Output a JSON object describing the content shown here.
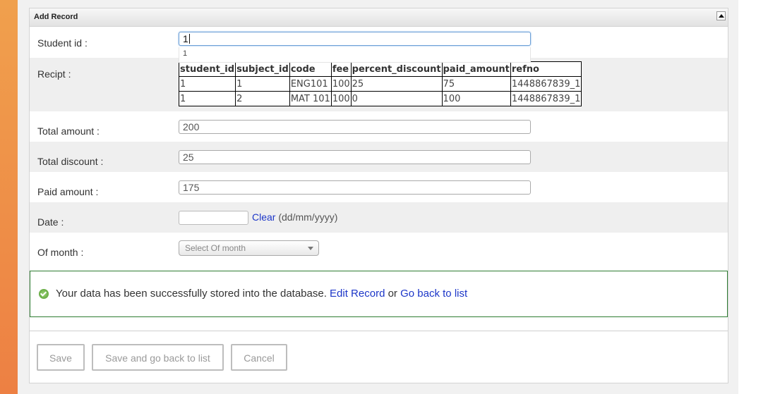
{
  "panel": {
    "title": "Add Record"
  },
  "fields": {
    "student_id": {
      "label": "Student id :",
      "value": "1",
      "suggestion": "1"
    },
    "recipt": {
      "label": "Recipt :"
    },
    "total_amount": {
      "label": "Total amount :",
      "value": "200"
    },
    "total_discount": {
      "label": "Total discount :",
      "value": "25"
    },
    "paid_amount": {
      "label": "Paid amount :",
      "value": "175"
    },
    "date": {
      "label": "Date :",
      "clear_label": "Clear",
      "hint": "(dd/mm/yyyy)"
    },
    "of_month": {
      "label": "Of month :",
      "placeholder": "Select Of month"
    }
  },
  "recipt_table": {
    "columns": [
      "student_id",
      "subject_id",
      "code",
      "fee",
      "percent_discount",
      "paid_amount",
      "refno"
    ],
    "rows": [
      [
        "1",
        "1",
        "ENG101",
        "100",
        "25",
        "75",
        "1448867839_1"
      ],
      [
        "1",
        "2",
        "MAT 101",
        "100",
        "0",
        "100",
        "1448867839_1"
      ]
    ]
  },
  "message": {
    "text": "Your data has been successfully stored into the database.",
    "edit_link": "Edit Record",
    "or_text": "or",
    "back_link": "Go back to list"
  },
  "buttons": {
    "save": "Save",
    "save_back": "Save and go back to list",
    "cancel": "Cancel"
  },
  "colors": {
    "accent_link": "#1c36c8",
    "success_border": "#2e7d32",
    "sidebar": "#f0a04d"
  }
}
